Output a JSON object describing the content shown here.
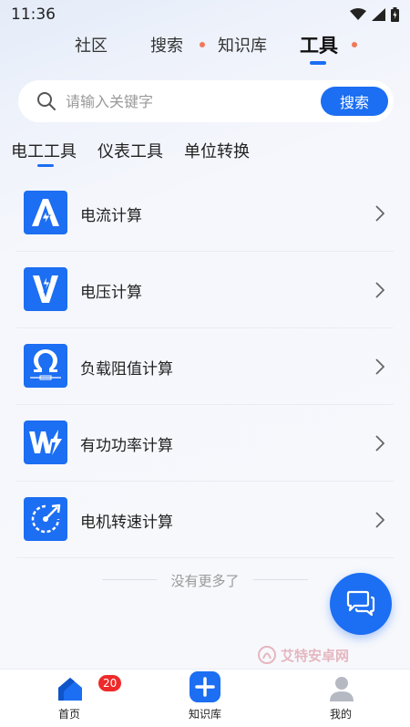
{
  "status_bar": {
    "time": "11:36",
    "icons": [
      "wifi-icon",
      "signal-icon",
      "battery-icon"
    ]
  },
  "top_tabs": [
    {
      "label": "社区",
      "active": false,
      "dot": false
    },
    {
      "label": "搜索",
      "active": false,
      "dot": true
    },
    {
      "label": "知识库",
      "active": false,
      "dot": false
    },
    {
      "label": "工具",
      "active": true,
      "dot": true
    }
  ],
  "search": {
    "placeholder": "请输入关键字",
    "value": "",
    "button_label": "搜索"
  },
  "sub_tabs": [
    {
      "label": "电工工具",
      "active": true
    },
    {
      "label": "仪表工具",
      "active": false
    },
    {
      "label": "单位转换",
      "active": false
    }
  ],
  "tools": [
    {
      "label": "电流计算",
      "icon": "current-icon"
    },
    {
      "label": "电压计算",
      "icon": "voltage-icon"
    },
    {
      "label": "负载阻值计算",
      "icon": "resistance-icon"
    },
    {
      "label": "有功功率计算",
      "icon": "power-icon"
    },
    {
      "label": "电机转速计算",
      "icon": "motor-speed-icon"
    }
  ],
  "footer_text": "没有更多了",
  "fab": {
    "icon": "chat-icon"
  },
  "watermark": {
    "text": "艾特安卓网"
  },
  "bottom_nav": [
    {
      "label": "首页",
      "icon": "home-icon",
      "badge": "20"
    },
    {
      "label": "知识库",
      "icon": "plus-icon",
      "badge": ""
    },
    {
      "label": "我的",
      "icon": "profile-icon",
      "badge": ""
    }
  ],
  "colors": {
    "accent": "#1c6ef2",
    "dot": "#f0795a",
    "badge": "#ee2a2a"
  }
}
